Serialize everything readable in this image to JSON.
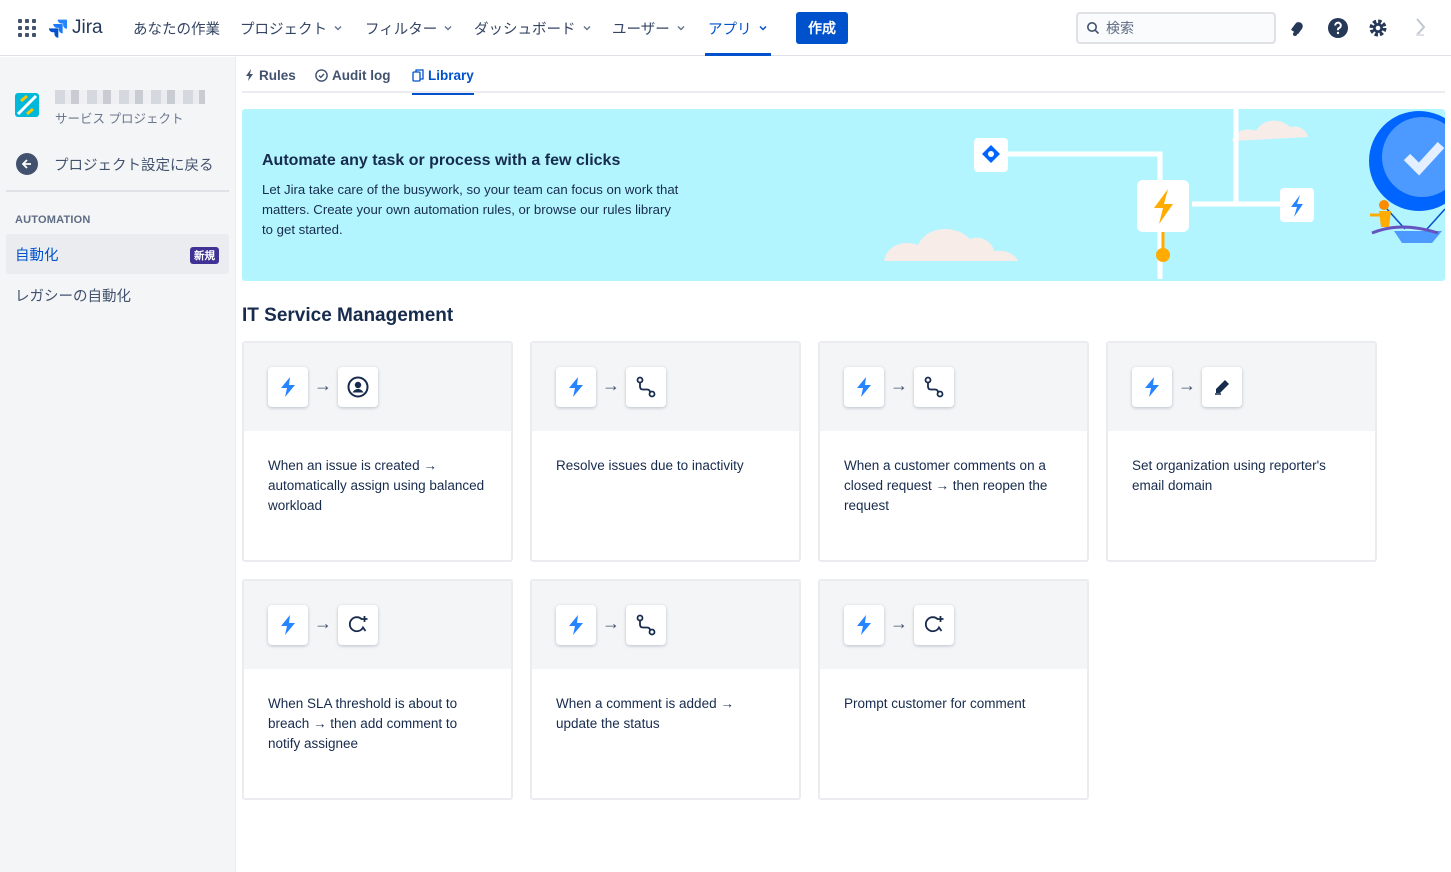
{
  "topnav": {
    "logo_text": "Jira",
    "items": [
      {
        "label": "あなたの作業",
        "dropdown": false
      },
      {
        "label": "プロジェクト",
        "dropdown": true
      },
      {
        "label": "フィルター",
        "dropdown": true
      },
      {
        "label": "ダッシュボード",
        "dropdown": true
      },
      {
        "label": "ユーザー",
        "dropdown": true
      },
      {
        "label": "アプリ",
        "dropdown": true,
        "active": true
      }
    ],
    "create_label": "作成",
    "search_placeholder": "検索",
    "icons": [
      "app-switcher-icon",
      "jira-logo-icon",
      "notifications-icon",
      "help-icon",
      "settings-icon",
      "profile-icon"
    ]
  },
  "sidebar": {
    "project_type": "サービス プロジェクト",
    "back_label": "プロジェクト設定に戻る",
    "section_label": "AUTOMATION",
    "items": [
      {
        "label": "自動化",
        "badge": "新規",
        "selected": true
      },
      {
        "label": "レガシーの自動化",
        "selected": false
      }
    ]
  },
  "tabs": [
    {
      "label": "Rules",
      "icon": "lightning-icon"
    },
    {
      "label": "Audit log",
      "icon": "check-circle-icon"
    },
    {
      "label": "Library",
      "icon": "copy-icon",
      "active": true
    }
  ],
  "banner": {
    "title": "Automate any task or process with a few clicks",
    "text": "Let Jira take care of the busywork, so your team can focus on work that matters. Create your own automation rules, or browse our rules library to get started.",
    "background": "#b3f5ff"
  },
  "section": {
    "title": "IT Service Management"
  },
  "cards": [
    {
      "text": "When an issue is created → automatically assign using balanced workload",
      "trigger_icon": "lightning-icon",
      "action_icon": "user-circle-icon"
    },
    {
      "text": "Resolve issues due to inactivity",
      "trigger_icon": "lightning-icon",
      "action_icon": "transition-icon"
    },
    {
      "text": "When a customer comments on a closed request → then reopen the request",
      "trigger_icon": "lightning-icon",
      "action_icon": "transition-icon"
    },
    {
      "text": "Set organization using reporter's email domain",
      "trigger_icon": "lightning-icon",
      "action_icon": "edit-icon"
    },
    {
      "text": "When SLA threshold is about to breach → then add comment to notify assignee",
      "trigger_icon": "lightning-icon",
      "action_icon": "add-comment-icon"
    },
    {
      "text": "When a comment is added → update the status",
      "trigger_icon": "lightning-icon",
      "action_icon": "transition-icon"
    },
    {
      "text": "Prompt customer for comment",
      "trigger_icon": "lightning-icon",
      "action_icon": "add-comment-icon"
    }
  ],
  "colors": {
    "brand": "#0052cc",
    "lightning": "#2684ff",
    "badge": "#403294",
    "sidebar_bg": "#f4f5f7"
  }
}
